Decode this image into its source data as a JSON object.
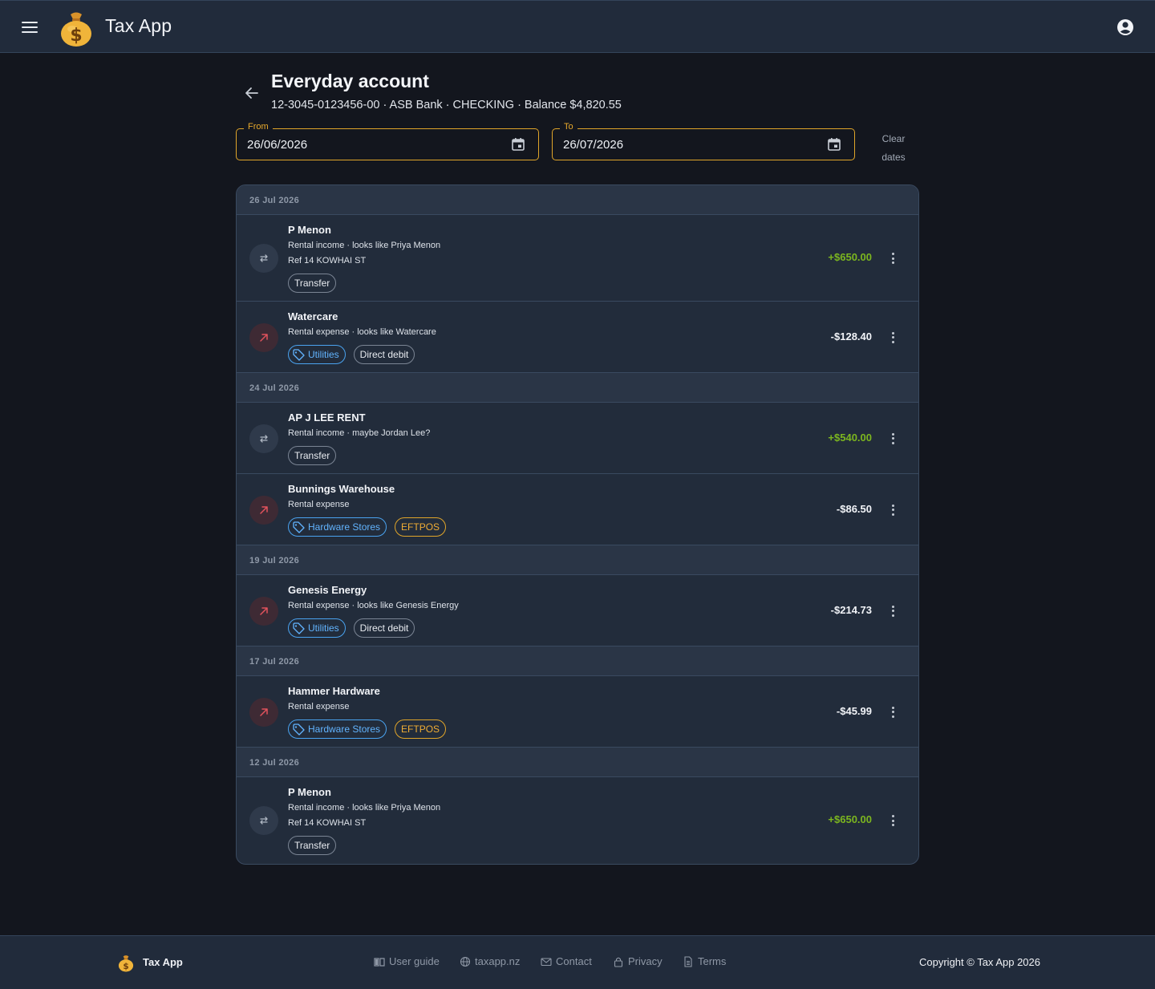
{
  "header": {
    "app_title": "Tax App",
    "menu_icon": "hamburger-menu-icon",
    "logo_icon": "money-bag-icon",
    "account_icon": "account-circle-icon"
  },
  "page": {
    "title": "Everyday account",
    "subtitle": "12-3045-0123456-00 · ASB Bank · CHECKING · Balance $4,820.55"
  },
  "filters": {
    "from_label": "From",
    "from_value": "26/06/2026",
    "to_label": "To",
    "to_value": "26/07/2026",
    "clear_line1": "Clear",
    "clear_line2": "dates"
  },
  "groups": [
    {
      "date": "26 Jul 2026",
      "transactions": [
        {
          "name": "P Menon",
          "desc": "Rental income · looks like Priya Menon",
          "ref": "Ref 14 KOWHAI ST",
          "amount": "+$650.00",
          "kind": "transfer",
          "chips": [
            {
              "label": "Transfer",
              "style": "neutral"
            }
          ]
        },
        {
          "name": "Watercare",
          "desc": "Rental expense · looks like Watercare",
          "ref": "",
          "amount": "-$128.40",
          "kind": "expense",
          "chips": [
            {
              "label": "Utilities",
              "style": "tag"
            },
            {
              "label": "Direct debit",
              "style": "neutral"
            }
          ]
        }
      ]
    },
    {
      "date": "24 Jul 2026",
      "transactions": [
        {
          "name": "AP J LEE RENT",
          "desc": "Rental income · maybe Jordan Lee?",
          "ref": "",
          "amount": "+$540.00",
          "kind": "transfer",
          "chips": [
            {
              "label": "Transfer",
              "style": "neutral"
            }
          ]
        },
        {
          "name": "Bunnings Warehouse",
          "desc": "Rental expense",
          "ref": "",
          "amount": "-$86.50",
          "kind": "expense",
          "chips": [
            {
              "label": "Hardware Stores",
              "style": "tag"
            },
            {
              "label": "EFTPOS",
              "style": "orange"
            }
          ]
        }
      ]
    },
    {
      "date": "19 Jul 2026",
      "transactions": [
        {
          "name": "Genesis Energy",
          "desc": "Rental expense · looks like Genesis Energy",
          "ref": "",
          "amount": "-$214.73",
          "kind": "expense",
          "chips": [
            {
              "label": "Utilities",
              "style": "tag"
            },
            {
              "label": "Direct debit",
              "style": "neutral"
            }
          ]
        }
      ]
    },
    {
      "date": "17 Jul 2026",
      "transactions": [
        {
          "name": "Hammer Hardware",
          "desc": "Rental expense",
          "ref": "",
          "amount": "-$45.99",
          "kind": "expense",
          "chips": [
            {
              "label": "Hardware Stores",
              "style": "tag"
            },
            {
              "label": "EFTPOS",
              "style": "orange"
            }
          ]
        }
      ]
    },
    {
      "date": "12 Jul 2026",
      "transactions": [
        {
          "name": "P Menon",
          "desc": "Rental income · looks like Priya Menon",
          "ref": "Ref 14 KOWHAI ST",
          "amount": "+$650.00",
          "kind": "transfer",
          "chips": [
            {
              "label": "Transfer",
              "style": "neutral"
            }
          ]
        }
      ]
    }
  ],
  "footer": {
    "brand": "Tax App",
    "links": [
      {
        "label": "User guide",
        "icon": "book-icon"
      },
      {
        "label": "taxapp.nz",
        "icon": "globe-icon"
      },
      {
        "label": "Contact",
        "icon": "mail-icon"
      },
      {
        "label": "Privacy",
        "icon": "lock-icon"
      },
      {
        "label": "Terms",
        "icon": "document-icon"
      }
    ],
    "copyright": "Copyright © Tax App 2026"
  },
  "colors": {
    "accent": "#e0a52a",
    "positive": "#7cb61f",
    "tag_blue": "#4aa3f0",
    "expense_icon": "#e0525c"
  }
}
